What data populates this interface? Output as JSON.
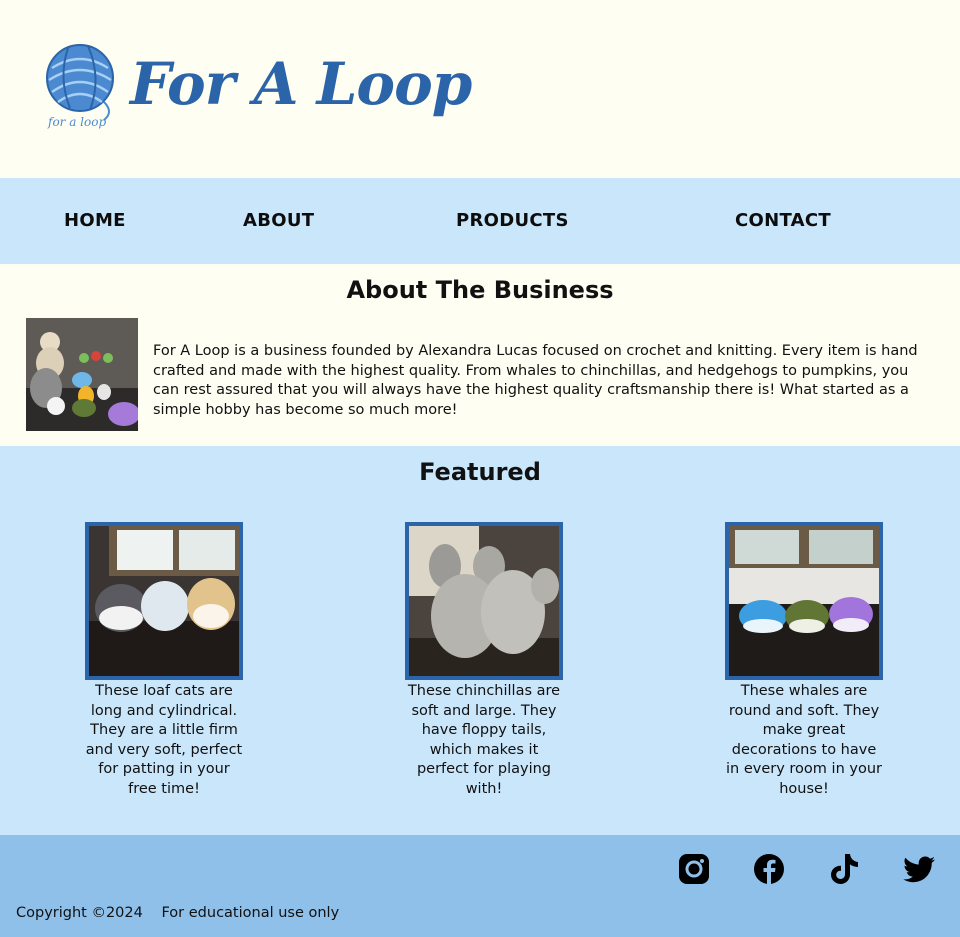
{
  "brand": {
    "name": "For A Loop",
    "logo_text": "for a loop"
  },
  "nav": {
    "items": [
      "HOME",
      "ABOUT",
      "PRODUCTS",
      "CONTACT"
    ]
  },
  "about": {
    "heading": "About The Business",
    "text": "For A Loop is a business founded by Alexandra Lucas focused on crochet and knitting. Every item is hand crafted and made with the highest quality. From whales to chinchillas, and hedgehogs to pumpkins, you can rest assured that you will always have the highest quality craftsmanship there is! What started as a simple hobby has become so much more!"
  },
  "featured": {
    "heading": "Featured",
    "items": [
      {
        "caption": "These loaf cats are long and cylindrical. They are a little firm and very soft, perfect for patting in your free time!"
      },
      {
        "caption": "These chinchillas are soft and large. They have floppy tails, which makes it perfect for playing with!"
      },
      {
        "caption": "These whales are round and soft. They make great decorations to have in every room in your house!"
      }
    ]
  },
  "footer": {
    "copyright": "Copyright ©2024",
    "note": "For educational use only",
    "social_icons": [
      "instagram-icon",
      "facebook-icon",
      "tiktok-icon",
      "twitter-icon"
    ]
  },
  "colors": {
    "cream": "#fffef2",
    "light_blue": "#c9e6fb",
    "footer_blue": "#8fc0ea",
    "brand_blue": "#2b64a8"
  }
}
